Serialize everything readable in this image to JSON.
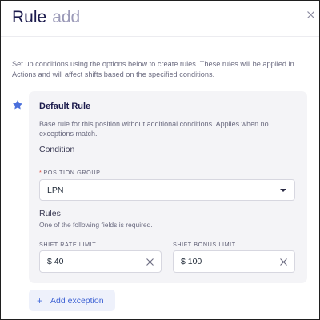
{
  "header": {
    "title": "Rule",
    "subtitle": "add",
    "close_icon": "close-icon"
  },
  "description": "Set up conditions using the options below to create rules. These rules will be applied in Actions and will affect shifts based on the specified conditions.",
  "default_rule": {
    "icon": "star-icon",
    "title": "Default Rule",
    "description": "Base rule for this position without additional conditions. Applies when no exceptions match.",
    "condition_label": "Condition",
    "position_group": {
      "required_marker": "*",
      "label": "POSITION GROUP",
      "value": "LPN"
    },
    "rules_label": "Rules",
    "rules_help": "One of the following fields is required.",
    "shift_rate_limit": {
      "label": "SHIFT RATE LIMIT",
      "value": "$ 40"
    },
    "shift_bonus_limit": {
      "label": "SHIFT BONUS LIMIT",
      "value": "$ 100"
    }
  },
  "add_exception": {
    "plus": "+",
    "label": "Add exception"
  },
  "colors": {
    "title": "#1c1b4d",
    "accent": "#4a6fdc",
    "card_bg": "#f4f4f7",
    "required": "#e0463a"
  }
}
